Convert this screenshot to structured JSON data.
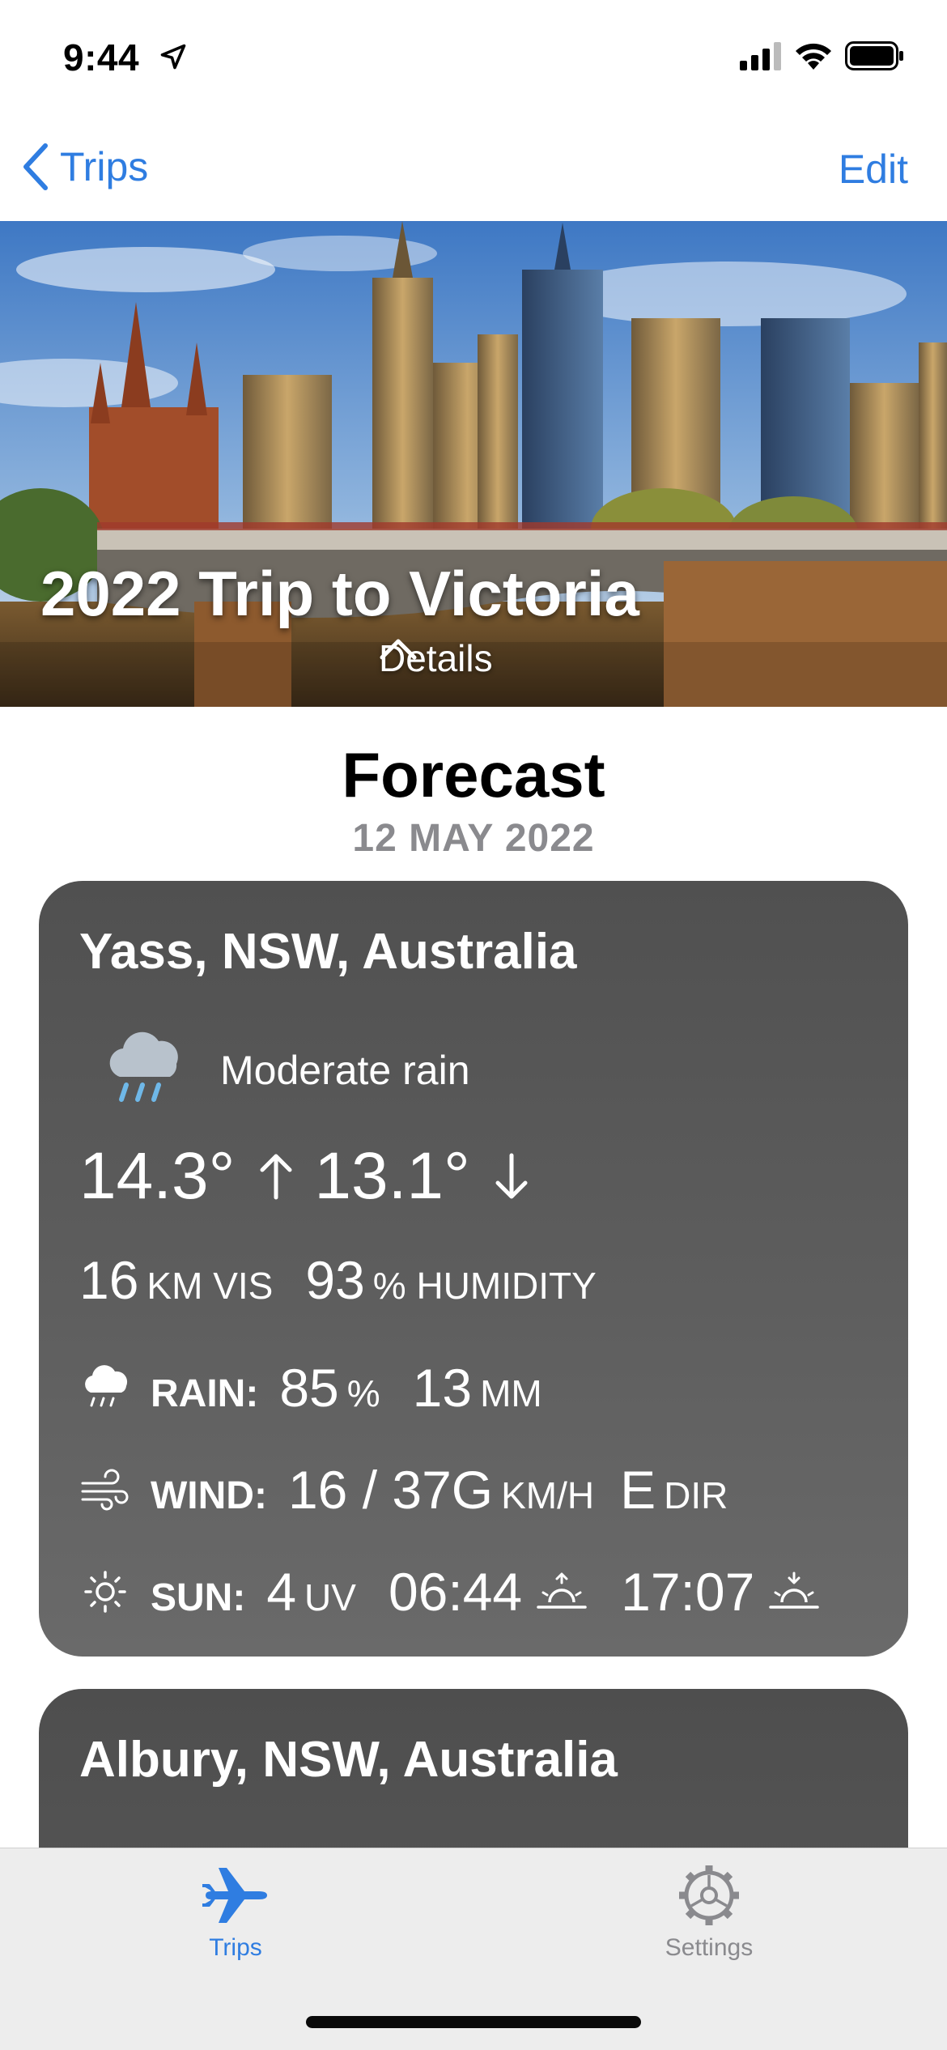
{
  "status_bar": {
    "time": "9:44"
  },
  "nav": {
    "back_label": "Trips",
    "edit_label": "Edit"
  },
  "hero": {
    "title": "2022 Trip to Victoria",
    "details_label": "Details"
  },
  "forecast": {
    "title": "Forecast",
    "date": "12 MAY 2022"
  },
  "cards": [
    {
      "location": "Yass, NSW, Australia",
      "condition": "Moderate rain",
      "high": "14.3°",
      "low": "13.1°",
      "visibility": "16",
      "visibility_unit": "KM VIS",
      "humidity": "93",
      "humidity_unit": "% HUMIDITY",
      "rain_label": "RAIN:",
      "rain_pct": "85",
      "rain_pct_unit": "%",
      "rain_mm": "13",
      "rain_mm_unit": "MM",
      "wind_label": "WIND:",
      "wind_speed": "16 / 37G",
      "wind_unit": "KM/H",
      "wind_dir": "E",
      "wind_dir_unit": "DIR",
      "sun_label": "SUN:",
      "uv": "4",
      "uv_unit": "UV",
      "sunrise": "06:44",
      "sunset": "17:07"
    },
    {
      "location": "Albury, NSW, Australia"
    }
  ],
  "tabs": [
    {
      "label": "Trips",
      "icon": "airplane-icon",
      "active": true
    },
    {
      "label": "Settings",
      "icon": "gear-icon",
      "active": false
    }
  ],
  "colors": {
    "accent": "#2f7de1",
    "card": "#5d5d5d",
    "tab_bar": "#ededed"
  }
}
